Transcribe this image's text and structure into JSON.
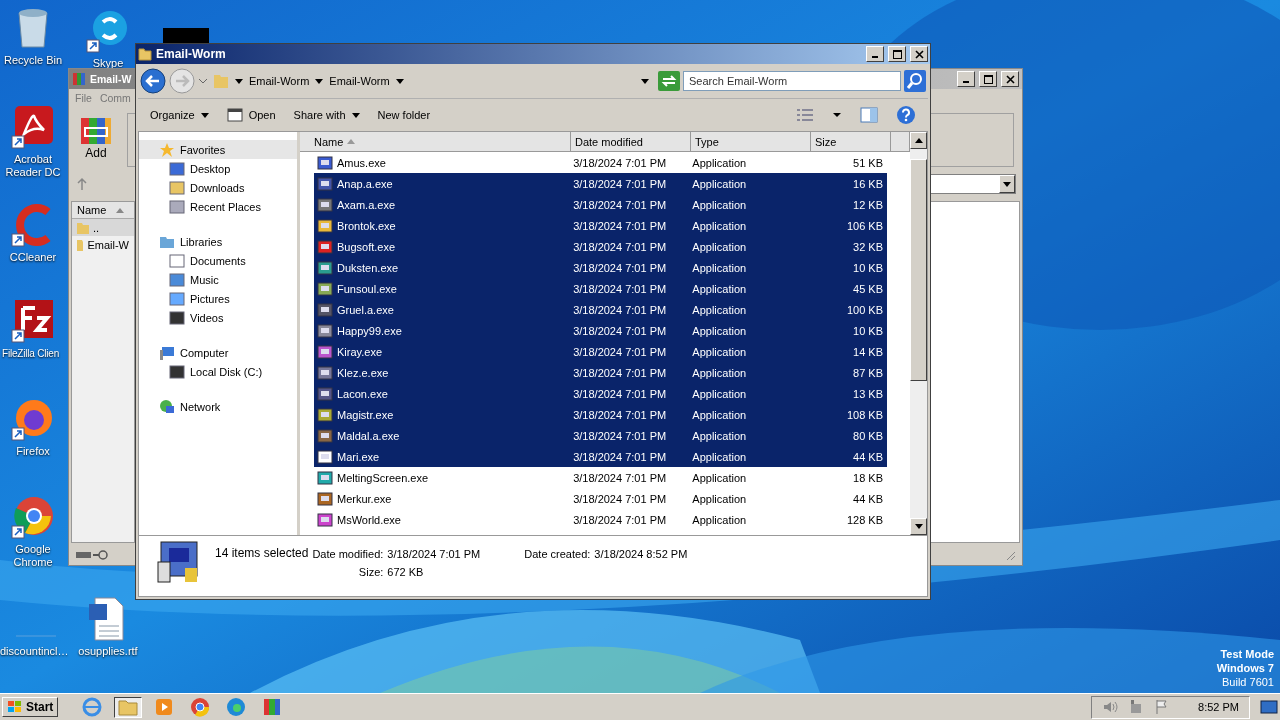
{
  "desktop_icons": [
    {
      "label": "Recycle Bin"
    },
    {
      "label": "Skype"
    },
    {
      "label": "Acrobat Reader DC"
    },
    {
      "label": "CCleaner"
    },
    {
      "label": "FileZilla Clien"
    },
    {
      "label": "Firefox"
    },
    {
      "label": "Google Chrome"
    },
    {
      "label": "discountincl…"
    },
    {
      "label": "osupplies.rtf"
    }
  ],
  "back_window": {
    "title": "Email-W",
    "menu": [
      "File",
      "Comm"
    ],
    "toolbar": [
      "Add"
    ],
    "column": "Name",
    "rows": [
      "..",
      "Email-W"
    ]
  },
  "window": {
    "title": "Email-Worm",
    "breadcrumb": [
      "Email-Worm",
      "Email-Worm"
    ],
    "search": {
      "placeholder": "Search Email-Worm"
    },
    "toolbar": [
      {
        "label": "Organize",
        "kind": "menu"
      },
      {
        "label": "Open",
        "kind": "icon"
      },
      {
        "label": "Share with",
        "kind": "menu"
      },
      {
        "label": "New folder",
        "kind": "plain"
      }
    ],
    "nav": [
      {
        "label": "Favorites",
        "selected": true,
        "children": [
          {
            "label": "Desktop"
          },
          {
            "label": "Downloads"
          },
          {
            "label": "Recent Places"
          }
        ]
      },
      {
        "label": "Libraries",
        "selected": false,
        "children": [
          {
            "label": "Documents"
          },
          {
            "label": "Music"
          },
          {
            "label": "Pictures"
          },
          {
            "label": "Videos"
          }
        ]
      },
      {
        "label": "Computer",
        "selected": false,
        "children": [
          {
            "label": "Local Disk (C:)"
          }
        ]
      },
      {
        "label": "Network",
        "selected": false
      }
    ],
    "columns": [
      {
        "label": "Name",
        "sorted": true
      },
      {
        "label": "Date modified",
        "sorted": false
      },
      {
        "label": "Type",
        "sorted": false
      },
      {
        "label": "Size",
        "sorted": false
      }
    ],
    "rows": [
      {
        "name": "Amus.exe",
        "date": "3/18/2024 7:01 PM",
        "type": "Application",
        "size": "51 KB",
        "selected": false
      },
      {
        "name": "Anap.a.exe",
        "date": "3/18/2024 7:01 PM",
        "type": "Application",
        "size": "16 KB",
        "selected": true
      },
      {
        "name": "Axam.a.exe",
        "date": "3/18/2024 7:01 PM",
        "type": "Application",
        "size": "12 KB",
        "selected": true
      },
      {
        "name": "Brontok.exe",
        "date": "3/18/2024 7:01 PM",
        "type": "Application",
        "size": "106 KB",
        "selected": true
      },
      {
        "name": "Bugsoft.exe",
        "date": "3/18/2024 7:01 PM",
        "type": "Application",
        "size": "32 KB",
        "selected": true
      },
      {
        "name": "Duksten.exe",
        "date": "3/18/2024 7:01 PM",
        "type": "Application",
        "size": "10 KB",
        "selected": true
      },
      {
        "name": "Funsoul.exe",
        "date": "3/18/2024 7:01 PM",
        "type": "Application",
        "size": "45 KB",
        "selected": true
      },
      {
        "name": "Gruel.a.exe",
        "date": "3/18/2024 7:01 PM",
        "type": "Application",
        "size": "100 KB",
        "selected": true
      },
      {
        "name": "Happy99.exe",
        "date": "3/18/2024 7:01 PM",
        "type": "Application",
        "size": "10 KB",
        "selected": true
      },
      {
        "name": "Kiray.exe",
        "date": "3/18/2024 7:01 PM",
        "type": "Application",
        "size": "14 KB",
        "selected": true
      },
      {
        "name": "Klez.e.exe",
        "date": "3/18/2024 7:01 PM",
        "type": "Application",
        "size": "87 KB",
        "selected": true
      },
      {
        "name": "Lacon.exe",
        "date": "3/18/2024 7:01 PM",
        "type": "Application",
        "size": "13 KB",
        "selected": true
      },
      {
        "name": "Magistr.exe",
        "date": "3/18/2024 7:01 PM",
        "type": "Application",
        "size": "108 KB",
        "selected": true
      },
      {
        "name": "Maldal.a.exe",
        "date": "3/18/2024 7:01 PM",
        "type": "Application",
        "size": "80 KB",
        "selected": true
      },
      {
        "name": "Mari.exe",
        "date": "3/18/2024 7:01 PM",
        "type": "Application",
        "size": "44 KB",
        "selected": true
      },
      {
        "name": "MeltingScreen.exe",
        "date": "3/18/2024 7:01 PM",
        "type": "Application",
        "size": "18 KB",
        "selected": false
      },
      {
        "name": "Merkur.exe",
        "date": "3/18/2024 7:01 PM",
        "type": "Application",
        "size": "44 KB",
        "selected": false
      },
      {
        "name": "MsWorld.exe",
        "date": "3/18/2024 7:01 PM",
        "type": "Application",
        "size": "128 KB",
        "selected": false
      }
    ],
    "details": {
      "count": "14 items selected",
      "modified_label": "Date modified:",
      "modified": "3/18/2024 7:01 PM",
      "created_label": "Date created:",
      "created": "3/18/2024 8:52 PM",
      "size_label": "Size:",
      "size": "672 KB"
    }
  },
  "os_notice": [
    "Test Mode",
    "Windows 7",
    "Build 7601"
  ],
  "taskbar": {
    "start": "Start",
    "apps": [
      {
        "selected": false
      },
      {
        "selected": true
      },
      {
        "selected": false
      },
      {
        "selected": false
      },
      {
        "selected": false
      },
      {
        "selected": false
      }
    ],
    "clock": "8:52 PM"
  }
}
